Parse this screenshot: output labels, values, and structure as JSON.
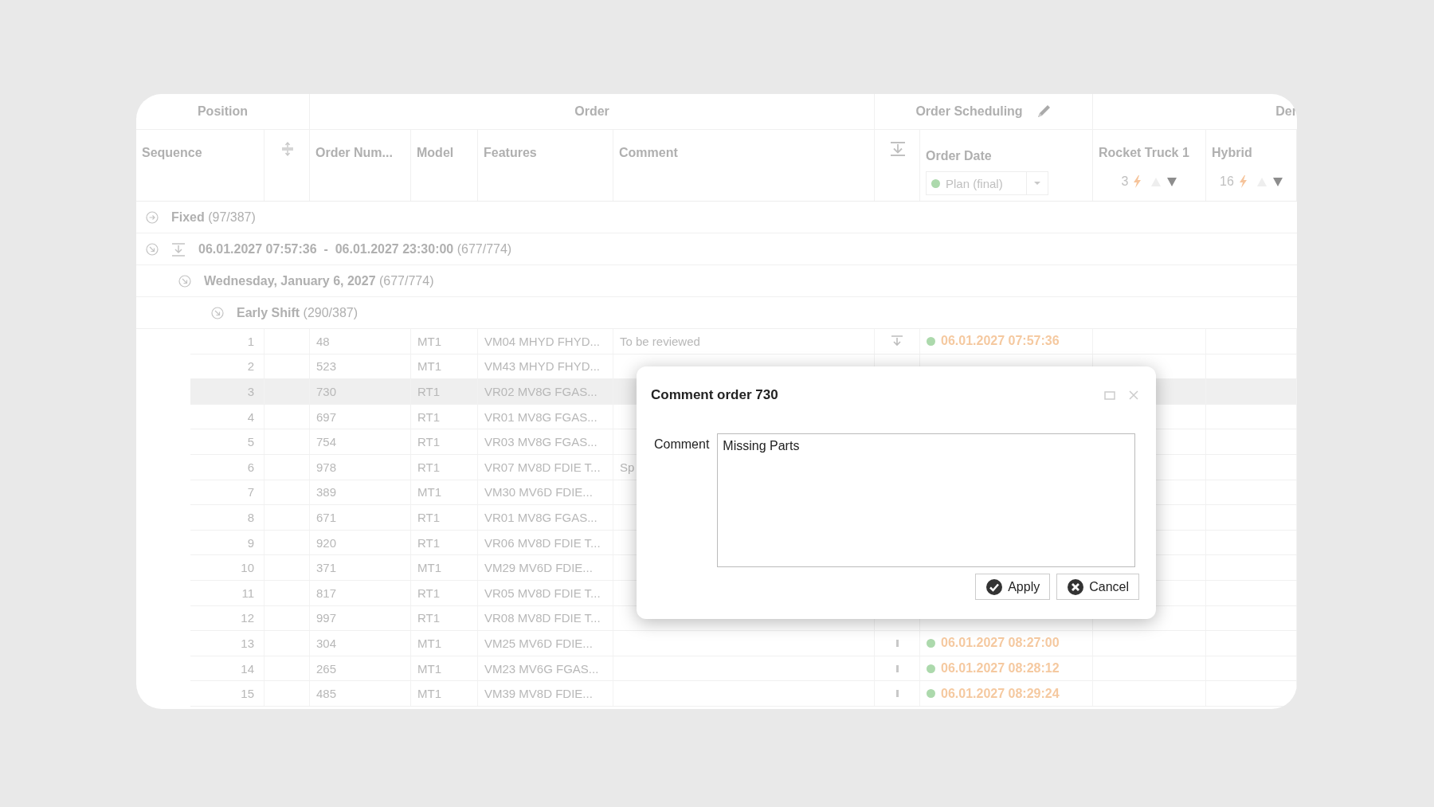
{
  "table": {
    "column_groups": [
      {
        "label": "Position"
      },
      {
        "label": "Order"
      },
      {
        "label": "Order Scheduling",
        "editable": true
      },
      {
        "label": "Der"
      }
    ],
    "columns": [
      {
        "kind": "text",
        "label": "Sequence"
      },
      {
        "kind": "icon"
      },
      {
        "kind": "text",
        "label": "Order Num..."
      },
      {
        "kind": "text",
        "label": "Model"
      },
      {
        "kind": "text",
        "label": "Features"
      },
      {
        "kind": "text",
        "label": "Comment"
      },
      {
        "kind": "icon"
      },
      {
        "kind": "filter",
        "label": "Order Date",
        "value": "Plan (final)"
      },
      {
        "kind": "count",
        "label": "Rocket Truck 1",
        "count": "3"
      },
      {
        "kind": "count",
        "label": "Hybrid",
        "count": "16"
      }
    ],
    "groups": [
      {
        "kind": "plain",
        "title": "Fixed",
        "count": "(97/387)",
        "expanded": false
      },
      {
        "kind": "range",
        "title": "06.01.2027 07:57:36  -  06.01.2027 23:30:00",
        "count": "(677/774)",
        "expanded": true,
        "children": [
          {
            "title": "Wednesday, January 6, 2027",
            "count": "(677/774)",
            "expanded": true,
            "children": [
              {
                "title": "Early Shift",
                "count": "(290/387)",
                "expanded": true
              }
            ]
          }
        ]
      }
    ],
    "rows": [
      {
        "sequence": "1",
        "order_number": "48",
        "model": "MT1",
        "features": "VM04 MHYD FHYD...",
        "comment": "To be reviewed",
        "kind": "pin",
        "order_date": "06.01.2027 07:57:36",
        "selected": false
      },
      {
        "sequence": "2",
        "order_number": "523",
        "model": "MT1",
        "features": "VM43 MHYD FHYD...",
        "selected": false
      },
      {
        "sequence": "3",
        "order_number": "730",
        "model": "RT1",
        "features": "VR02 MV8G FGAS...",
        "selected": true
      },
      {
        "sequence": "4",
        "order_number": "697",
        "model": "RT1",
        "features": "VR01 MV8G FGAS...",
        "selected": false
      },
      {
        "sequence": "5",
        "order_number": "754",
        "model": "RT1",
        "features": "VR03 MV8G FGAS...",
        "selected": false
      },
      {
        "sequence": "6",
        "order_number": "978",
        "model": "RT1",
        "features": "VR07 MV8D FDIE T...",
        "comment": "Sp",
        "selected": false
      },
      {
        "sequence": "7",
        "order_number": "389",
        "model": "MT1",
        "features": "VM30 MV6D FDIE...",
        "selected": false
      },
      {
        "sequence": "8",
        "order_number": "671",
        "model": "RT1",
        "features": "VR01 MV8G FGAS...",
        "selected": false
      },
      {
        "sequence": "9",
        "order_number": "920",
        "model": "RT1",
        "features": "VR06 MV8D FDIE T...",
        "selected": false
      },
      {
        "sequence": "10",
        "order_number": "371",
        "model": "MT1",
        "features": "VM29 MV6D FDIE...",
        "selected": false
      },
      {
        "sequence": "11",
        "order_number": "817",
        "model": "RT1",
        "features": "VR05 MV8D FDIE T...",
        "selected": false
      },
      {
        "sequence": "12",
        "order_number": "997",
        "model": "RT1",
        "features": "VR08 MV8D FDIE T...",
        "selected": false
      },
      {
        "sequence": "13",
        "order_number": "304",
        "model": "MT1",
        "features": "VM25 MV6D FDIE...",
        "kind": "bar",
        "order_date": "06.01.2027 08:27:00",
        "selected": false
      },
      {
        "sequence": "14",
        "order_number": "265",
        "model": "MT1",
        "features": "VM23 MV6G FGAS...",
        "kind": "bar",
        "order_date": "06.01.2027 08:28:12",
        "selected": false
      },
      {
        "sequence": "15",
        "order_number": "485",
        "model": "MT1",
        "features": "VM39 MV8D FDIE...",
        "kind": "bar",
        "order_date": "06.01.2027 08:29:24",
        "selected": false
      }
    ]
  },
  "dialog": {
    "title": "Comment order 730",
    "label": "Comment",
    "value": "Missing Parts",
    "buttons": [
      {
        "kind": "apply",
        "label": "Apply"
      },
      {
        "kind": "cancel",
        "label": "Cancel"
      }
    ]
  }
}
